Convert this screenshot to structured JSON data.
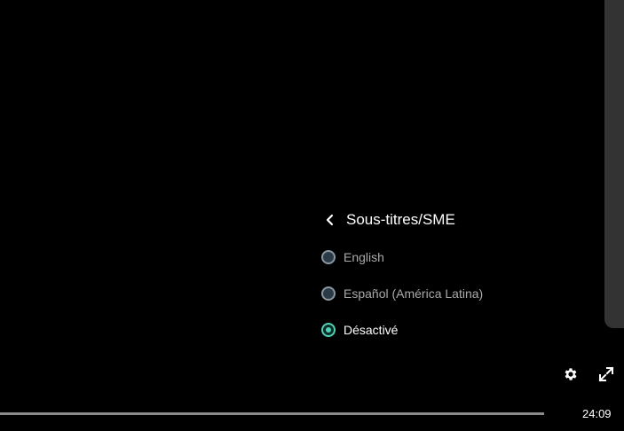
{
  "subtitles_menu": {
    "title": "Sous-titres/SME",
    "back_icon": "chevron-left-icon",
    "options": [
      {
        "label": "English",
        "selected": false
      },
      {
        "label": "Español (América Latina)",
        "selected": false
      },
      {
        "label": "Désactivé",
        "selected": true
      }
    ]
  },
  "controls": {
    "settings_icon": "gear-icon",
    "fullscreen_icon": "expand-icon",
    "time": "24:09",
    "progress": 1.0
  },
  "colors": {
    "background": "#000000",
    "accent": "#4fd1b5",
    "side_panel": "#333333"
  }
}
